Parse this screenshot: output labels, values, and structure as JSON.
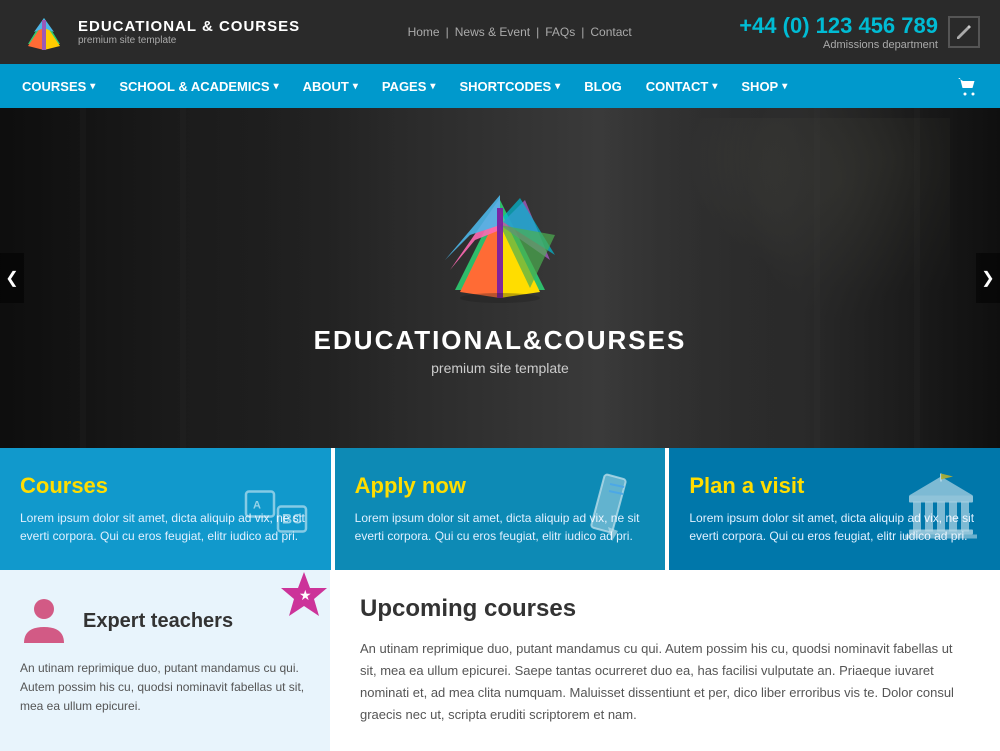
{
  "header": {
    "site_name": "EDUCATIONAL & COURSES",
    "tagline": "premium site template",
    "phone": "+44 (0) 123 456 789",
    "admissions_label": "Admissions department",
    "nav_links": [
      "Home",
      "News & Event",
      "FAQs",
      "Contact"
    ]
  },
  "navbar": {
    "items": [
      {
        "label": "COURSES",
        "has_dropdown": true
      },
      {
        "label": "SCHOOL & ACADEMICS",
        "has_dropdown": true
      },
      {
        "label": "ABOUT",
        "has_dropdown": true
      },
      {
        "label": "PAGES",
        "has_dropdown": true
      },
      {
        "label": "SHORTCODES",
        "has_dropdown": true
      },
      {
        "label": "BLOG",
        "has_dropdown": false
      },
      {
        "label": "CONTACT",
        "has_dropdown": true
      },
      {
        "label": "SHOP",
        "has_dropdown": true
      }
    ]
  },
  "hero": {
    "title": "EDUCATIONAL&COURSES",
    "subtitle": "premium site template"
  },
  "feature_cards": [
    {
      "id": "courses",
      "title": "Courses",
      "text": "Lorem ipsum dolor sit amet, dicta aliquip ad vix, ne sit everti corpora. Qui cu eros feugiat, elitr iudico ad pri.",
      "icon": "abc"
    },
    {
      "id": "apply",
      "title": "Apply now",
      "text": "Lorem ipsum dolor sit amet, dicta aliquip ad vix, ne sit everti corpora. Qui cu eros feugiat, elitr iudico ad pri.",
      "icon": "pencil"
    },
    {
      "id": "visit",
      "title": "Plan a visit",
      "text": "Lorem ipsum dolor sit amet, dicta aliquip ad vix, ne sit everti corpora. Qui cu eros feugiat, elitr iudico ad pri.",
      "icon": "building"
    }
  ],
  "sidebar_widget": {
    "title": "Expert teachers",
    "text": "An utinam reprimique duo, putant mandamus cu qui. Autem possim his cu, quodsi nominavit fabellas ut sit, mea ea ullum epicurei."
  },
  "main_content": {
    "title": "Upcoming courses",
    "text": "An utinam reprimique duo, putant mandamus cu qui. Autem possim his cu, quodsi nominavit fabellas ut sit, mea ea ullum epicurei. Saepe tantas ocurreret duo ea, has facilisi vulputate an. Priaeque iuvaret nominati et, ad mea clita numquam. Maluisset dissentiunt et per, dico liber erroribus vis te. Dolor consul graecis nec ut, scripta eruditi scriptorem et nam."
  }
}
